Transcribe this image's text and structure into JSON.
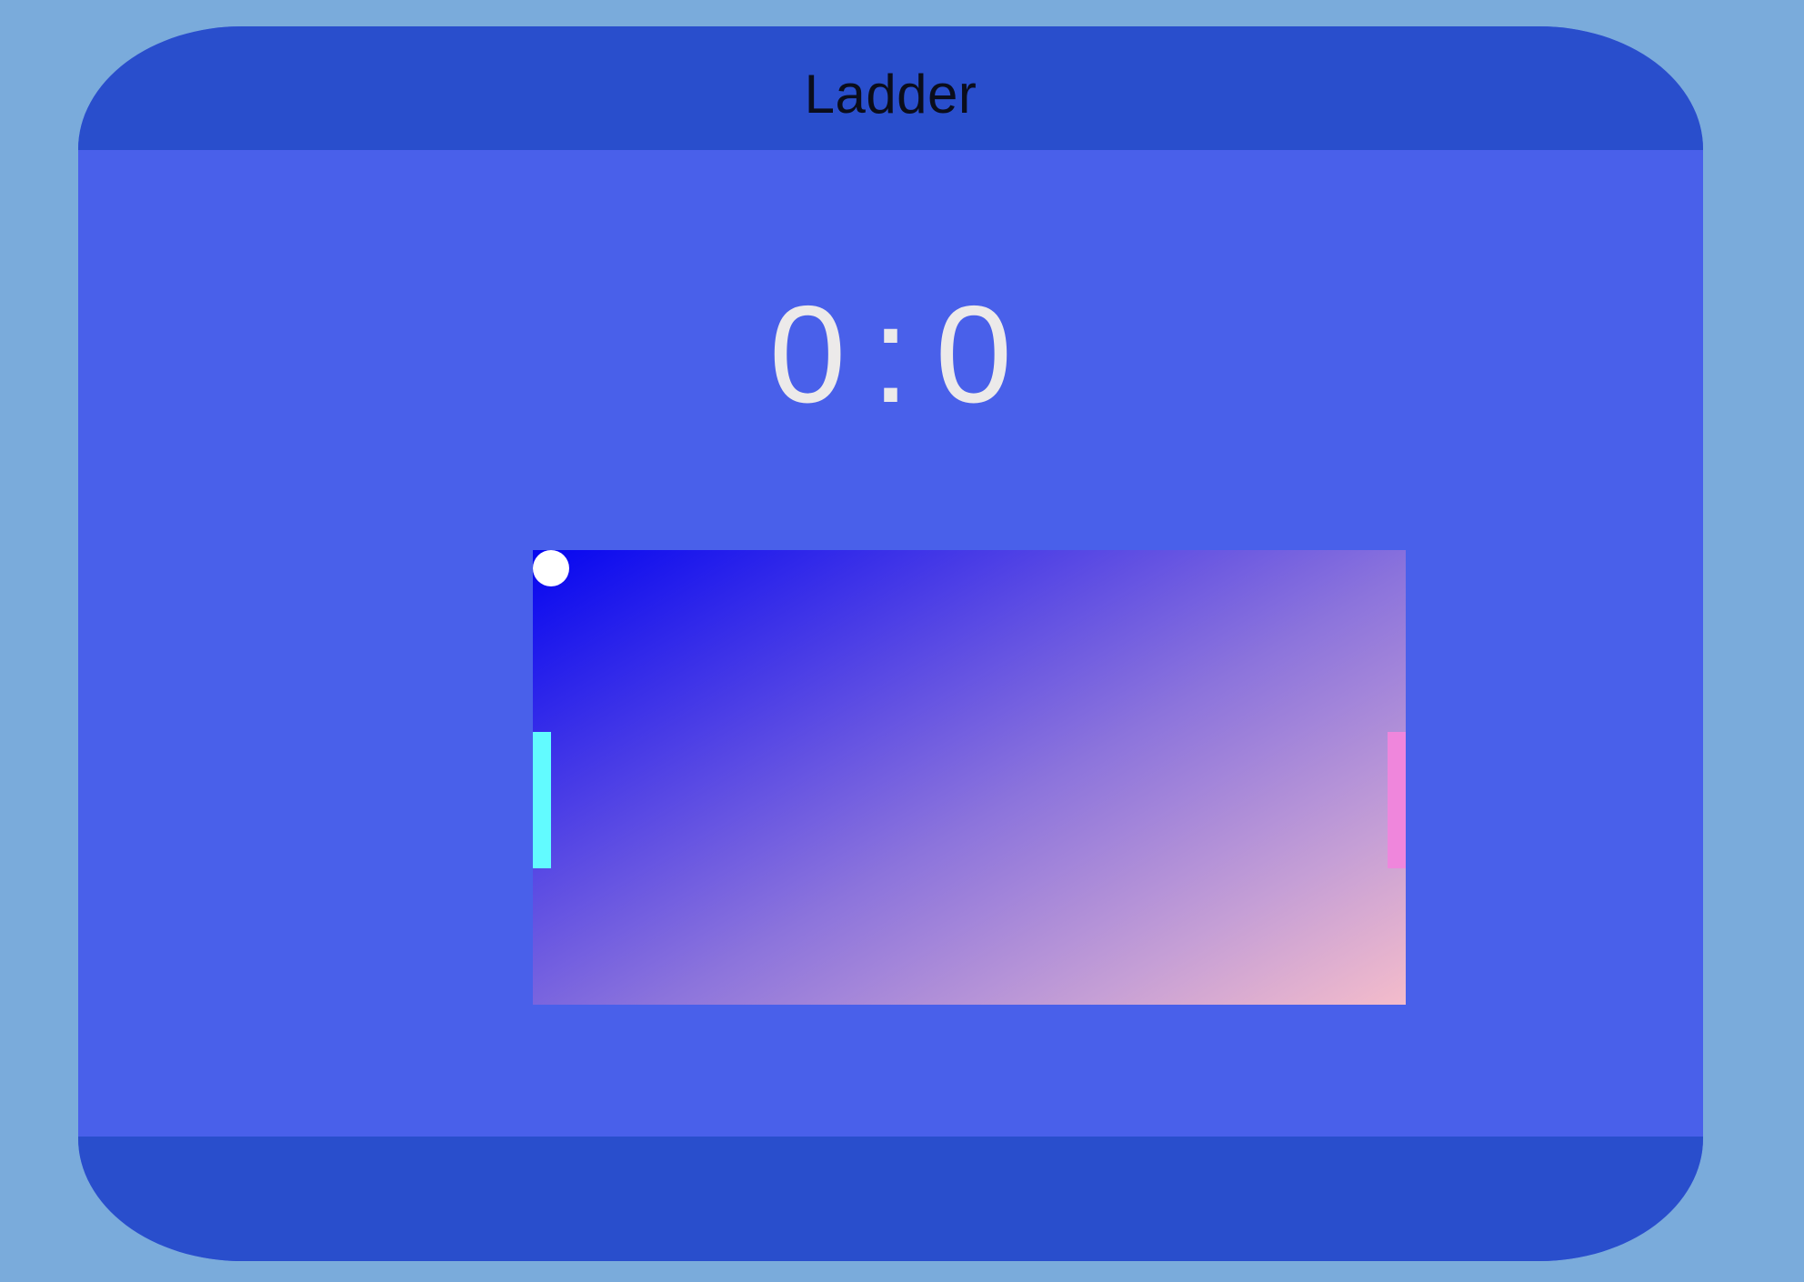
{
  "header": {
    "title": "Ladder"
  },
  "score": {
    "left": "0",
    "separator": ":",
    "right": "0"
  },
  "colors": {
    "page_background": "#7aabdb",
    "bar_background": "#294ecc",
    "panel_background": "#4960ea",
    "score_text": "#eceaea",
    "left_paddle": "#62fbff",
    "right_paddle": "#ef86dc",
    "ball": "#ffffff",
    "field_gradient_start": "#0606f0",
    "field_gradient_end": "#f4bccb"
  }
}
